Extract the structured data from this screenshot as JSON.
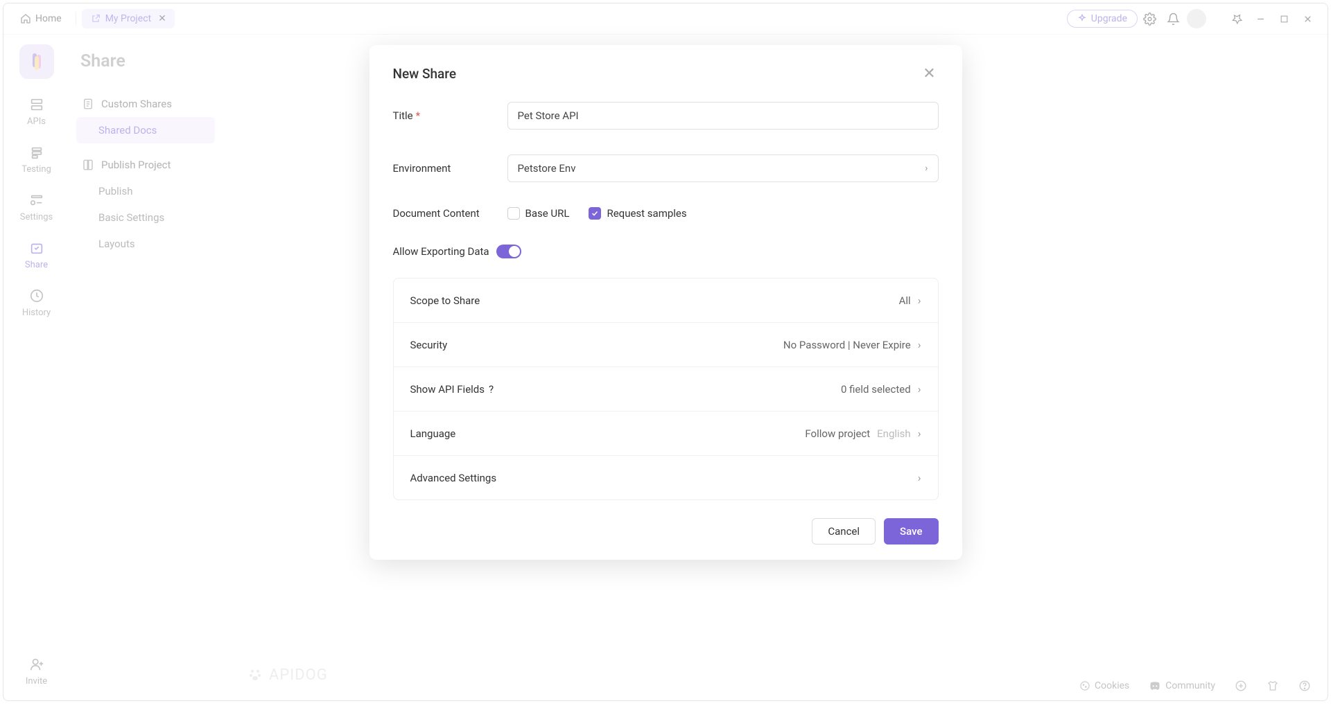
{
  "topbar": {
    "home_label": "Home",
    "tab_label": "My Project",
    "upgrade_label": "Upgrade"
  },
  "sidebar": {
    "title": "Share",
    "nav": [
      {
        "label": "APIs"
      },
      {
        "label": "Testing"
      },
      {
        "label": "Settings"
      },
      {
        "label": "Share"
      },
      {
        "label": "History"
      },
      {
        "label": "Invite"
      }
    ],
    "group1_label": "Custom Shares",
    "group1_sub_label": "Shared Docs",
    "group2_label": "Publish Project",
    "group2_subs": [
      "Publish",
      "Basic Settings",
      "Layouts"
    ]
  },
  "modal": {
    "title": "New Share",
    "title_field_label": "Title",
    "title_field_value": "Pet Store API",
    "env_label": "Environment",
    "env_value": "Petstore Env",
    "doc_content_label": "Document Content",
    "cb_base_url": "Base URL",
    "cb_request_samples": "Request samples",
    "allow_export_label": "Allow Exporting Data",
    "rows": {
      "scope_label": "Scope to Share",
      "scope_value": "All",
      "security_label": "Security",
      "security_value": "No Password | Never Expire",
      "fields_label": "Show API Fields",
      "fields_value": "0 field selected",
      "language_label": "Language",
      "language_primary": "Follow project",
      "language_secondary": "English",
      "advanced_label": "Advanced Settings"
    },
    "cancel_label": "Cancel",
    "save_label": "Save"
  },
  "footer": {
    "cookies": "Cookies",
    "community": "Community"
  },
  "watermark": "APIDOG"
}
